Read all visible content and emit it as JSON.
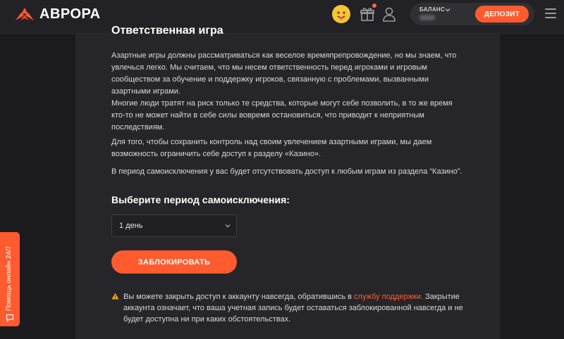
{
  "header": {
    "brand": "АВРОРА",
    "balance_label": "БАЛАНС",
    "deposit_label": "ДЕПОЗИТ",
    "icons": [
      "aurora-logo-icon",
      "emoji-face-icon",
      "gift-icon",
      "user-icon",
      "chevron-down-icon",
      "menu-icon"
    ],
    "colors": {
      "accent": "#ff5b2e",
      "background": "#1b1b1e",
      "card": "#26262a"
    }
  },
  "content": {
    "title": "Ответственная игра",
    "paragraphs": [
      "Азартные игры должны рассматриваться как веселое времяпрепровождение, но мы знаем, что увлечься легко. Мы считаем, что мы несем ответственность перед игроками и игровым сообществом за обучение и поддержку игроков, связанную с проблемами, вызванными азартными играми.",
      "Многие люди тратят на риск только те средства, которые могут себе позволить, в то же время кто-то не может найти в себе силы вовремя остановиться, что приводит к неприятным последствиям.",
      "Для того, чтобы сохранить контроль над своим увлечением азартными играми, мы даем возможность ограничить себе доступ к разделу «Казино».",
      "В период самоисключения у вас будет отсутствовать доступ к любым играм из раздела “Казино”."
    ],
    "period_heading": "Выберите период самоисключения:",
    "period_selected": "1 день",
    "block_button": "ЗАБЛОКИРОВАТЬ",
    "warning_before": "Вы можете закрыть доступ к аккаунту навсегда, обратившись в ",
    "warning_link": "службу поддержки.",
    "warning_after": " Закрытие аккаунта означает, что ваша учетная запись будет оставаться заблокированной навсегда и не будет доступна ни при каких обстоятельствах."
  },
  "help": {
    "label": "Помощь онлайн 24/7"
  }
}
